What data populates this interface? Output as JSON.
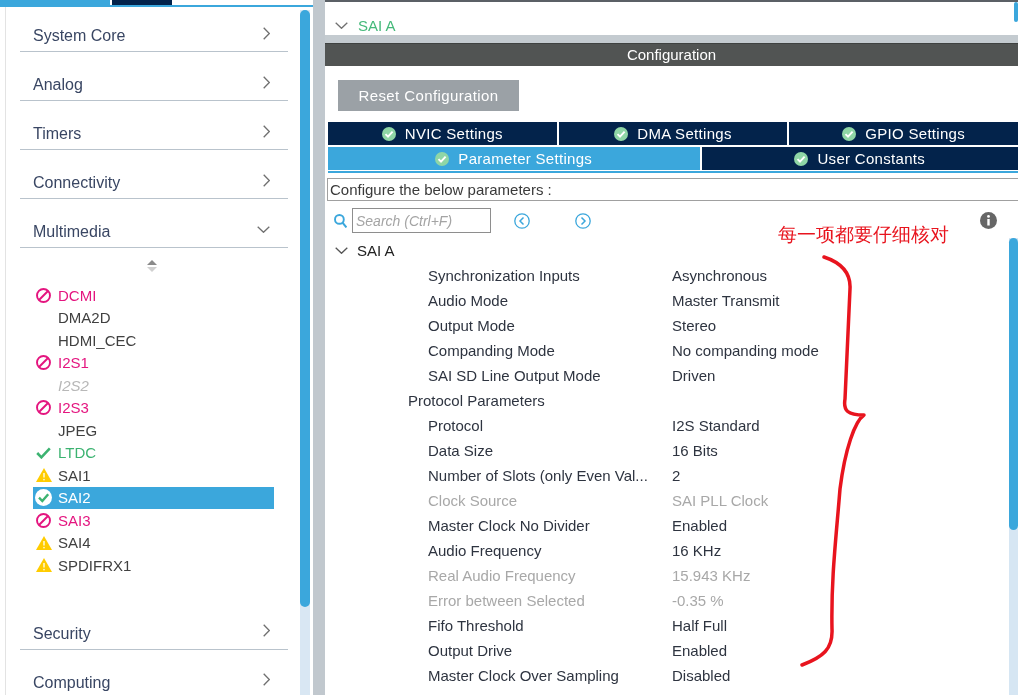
{
  "sidebar": {
    "top_tabs": [
      {
        "selected": true
      },
      {
        "selected": false
      }
    ],
    "categories": [
      {
        "label": "System Core",
        "expanded": false
      },
      {
        "label": "Analog",
        "expanded": false
      },
      {
        "label": "Timers",
        "expanded": false
      },
      {
        "label": "Connectivity",
        "expanded": false
      },
      {
        "label": "Multimedia",
        "expanded": true,
        "children": [
          {
            "kind": "error",
            "label": "DCMI",
            "selected": false
          },
          {
            "kind": "plain",
            "label": "DMA2D",
            "selected": false
          },
          {
            "kind": "plain",
            "label": "HDMI_CEC",
            "selected": false
          },
          {
            "kind": "error",
            "label": "I2S1",
            "selected": false
          },
          {
            "kind": "disabled",
            "label": "I2S2",
            "selected": false
          },
          {
            "kind": "error",
            "label": "I2S3",
            "selected": false
          },
          {
            "kind": "plain",
            "label": "JPEG",
            "selected": false
          },
          {
            "kind": "ok",
            "label": "LTDC",
            "selected": false
          },
          {
            "kind": "warning",
            "label": "SAI1",
            "selected": false
          },
          {
            "kind": "ok",
            "label": "SAI2",
            "selected": true
          },
          {
            "kind": "error",
            "label": "SAI3",
            "selected": false
          },
          {
            "kind": "warning",
            "label": "SAI4",
            "selected": false
          },
          {
            "kind": "warning",
            "label": "SPDIFRX1",
            "selected": false
          }
        ]
      },
      {
        "label": "Security",
        "expanded": false
      },
      {
        "label": "Computing",
        "expanded": false
      }
    ]
  },
  "mode_section": {
    "label": "SAI A",
    "expanded": true
  },
  "configuration": {
    "title": "Configuration",
    "reset_button": "Reset Configuration",
    "tab_rows": [
      [
        {
          "label": "NVIC Settings",
          "valid": true,
          "selected": false
        },
        {
          "label": "DMA Settings",
          "valid": true,
          "selected": false
        },
        {
          "label": "GPIO Settings",
          "valid": true,
          "selected": false
        }
      ],
      [
        {
          "label": "Parameter Settings",
          "valid": true,
          "selected": true
        },
        {
          "label": "User Constants",
          "valid": true,
          "selected": false
        }
      ]
    ],
    "hint": "Configure the below parameters :",
    "search": {
      "placeholder": "Search (Ctrl+F)"
    },
    "sections": [
      {
        "label": "SAI A",
        "expanded": true,
        "children": [
          {
            "kind": "param",
            "label": "Synchronization Inputs",
            "value": "Asynchronous",
            "disabled": false
          },
          {
            "kind": "param",
            "label": "Audio Mode",
            "value": "Master Transmit",
            "disabled": false
          },
          {
            "kind": "param",
            "label": "Output Mode",
            "value": "Stereo",
            "disabled": false
          },
          {
            "kind": "param",
            "label": "Companding Mode",
            "value": "No companding mode",
            "disabled": false
          },
          {
            "kind": "param",
            "label": "SAI SD Line Output Mode",
            "value": "Driven",
            "disabled": false
          },
          {
            "kind": "group",
            "label": "Protocol Parameters",
            "children": [
              {
                "kind": "param",
                "label": "Protocol",
                "value": "I2S Standard",
                "disabled": false
              },
              {
                "kind": "param",
                "label": "Data Size",
                "value": "16 Bits",
                "disabled": false
              },
              {
                "kind": "param",
                "label": "Number of Slots (only Even Val...",
                "value": "2",
                "disabled": false
              },
              {
                "kind": "param",
                "label": "Clock Source",
                "value": "SAI PLL Clock",
                "disabled": true
              },
              {
                "kind": "param",
                "label": "Master Clock No Divider",
                "value": "Enabled",
                "disabled": false
              },
              {
                "kind": "param",
                "label": "Audio Frequency",
                "value": "16 KHz",
                "disabled": false
              },
              {
                "kind": "param",
                "label": "Real Audio Frequency",
                "value": "15.943 KHz",
                "disabled": true
              },
              {
                "kind": "param",
                "label": "Error between Selected",
                "value": "-0.35 %",
                "disabled": true
              },
              {
                "kind": "param",
                "label": "Fifo Threshold",
                "value": "Half Full",
                "disabled": false
              },
              {
                "kind": "param",
                "label": "Output Drive",
                "value": "Enabled",
                "disabled": false
              },
              {
                "kind": "param",
                "label": "Master Clock Over Sampling",
                "value": "Disabled",
                "disabled": false
              }
            ]
          }
        ]
      }
    ]
  },
  "annotation": {
    "text": "每一项都要仔细核对"
  }
}
